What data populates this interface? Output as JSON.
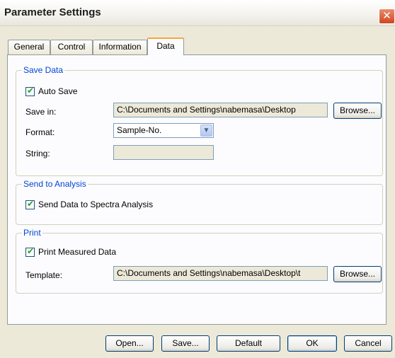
{
  "window": {
    "title": "Parameter Settings",
    "close_glyph": "✕"
  },
  "tabs": [
    {
      "label": "General",
      "active": false
    },
    {
      "label": "Control",
      "active": false
    },
    {
      "label": "Information",
      "active": false
    },
    {
      "label": "Data",
      "active": true
    }
  ],
  "save_data": {
    "group_title": "Save Data",
    "auto_save_label": "Auto Save",
    "auto_save_checked": true,
    "save_in_label": "Save in:",
    "save_in_value": "C:\\Documents and Settings\\nabemasa\\Desktop",
    "browse_label": "Browse...",
    "format_label": "Format:",
    "format_value": "Sample-No.",
    "string_label": "String:",
    "string_value": ""
  },
  "send_to_analysis": {
    "group_title": "Send to Analysis",
    "send_data_label": "Send Data to Spectra Analysis",
    "send_data_checked": true
  },
  "print": {
    "group_title": "Print",
    "print_measured_label": "Print Measured Data",
    "print_measured_checked": true,
    "template_label": "Template:",
    "template_value": "C:\\Documents and Settings\\nabemasa\\Desktop\\t",
    "browse_label": "Browse..."
  },
  "footer": {
    "open_label": "Open...",
    "save_label": "Save...",
    "default_label": "Default",
    "ok_label": "OK",
    "cancel_label": "Cancel"
  },
  "icons": {
    "check_glyph": "✔",
    "dropdown_glyph": "▼"
  }
}
